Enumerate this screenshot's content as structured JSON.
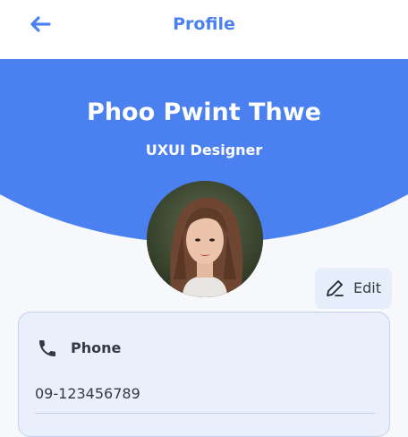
{
  "header": {
    "title": "Profile",
    "back_icon": "back-arrow-icon",
    "accent_color": "#4a80f0"
  },
  "profile": {
    "name": "Phoo Pwint Thwe",
    "role": "UXUI Designer",
    "avatar": "profile-photo"
  },
  "edit": {
    "label": "Edit",
    "icon": "pencil-icon"
  },
  "contact": {
    "phone_label": "Phone",
    "phone_icon": "phone-icon",
    "phone_value": "09-123456789"
  }
}
